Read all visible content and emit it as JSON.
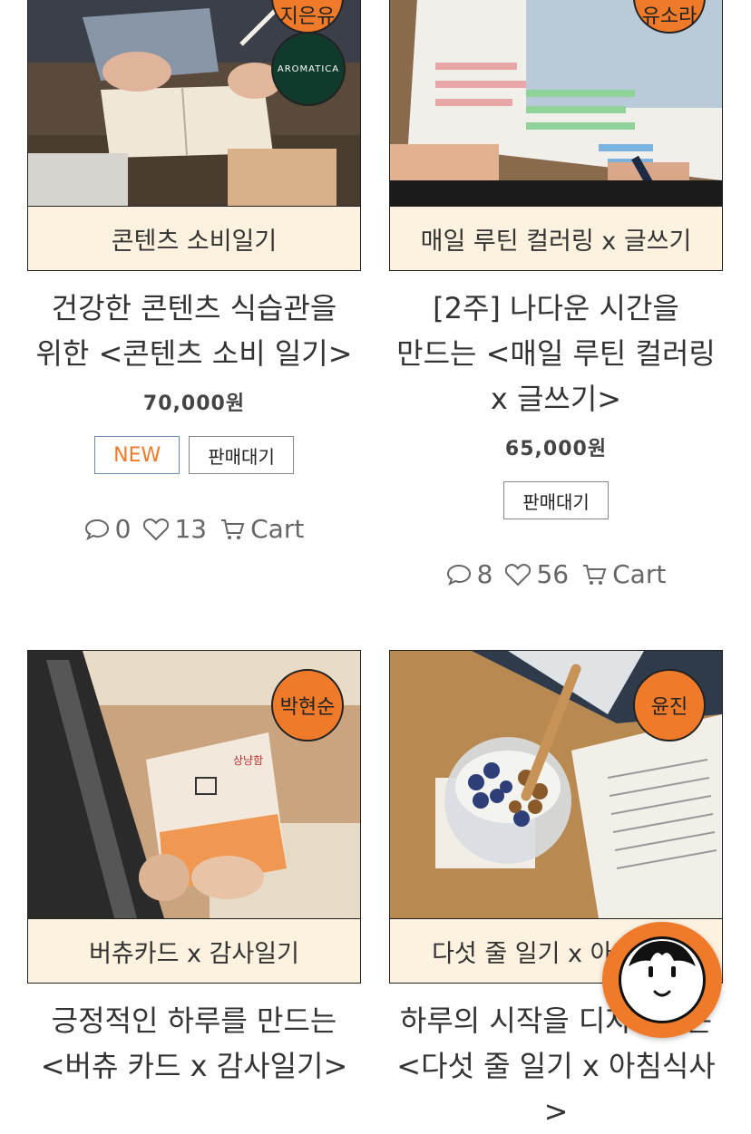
{
  "products": [
    {
      "badge": "지은유",
      "ribbon": "콘텐츠 소비일기",
      "title_lines": [
        "건강한 콘텐츠 식습관을",
        "위한 <콘텐츠 소비 일기>"
      ],
      "price": "70,000원",
      "tags": [
        "NEW",
        "판매대기"
      ],
      "comments": "0",
      "likes": "13",
      "cart_label": "Cart",
      "logo_text": "AROMATICA"
    },
    {
      "badge": "유소라",
      "ribbon": "매일 루틴 컬러링 x 글쓰기",
      "title_lines": [
        "[2주] 나다운 시간을",
        "만드는 <매일 루틴 컬러링",
        "x 글쓰기>"
      ],
      "price": "65,000원",
      "tags": [
        "판매대기"
      ],
      "comments": "8",
      "likes": "56",
      "cart_label": "Cart"
    },
    {
      "badge": "박현순",
      "ribbon": "버츄카드 x 감사일기",
      "title_lines": [
        "긍정적인 하루를 만드는",
        "<버츄 카드 x 감사일기>"
      ],
      "card_text": "상냥함"
    },
    {
      "badge": "윤진",
      "ribbon": "다섯 줄 일기 x 아침식사",
      "title_lines": [
        "하루의 시작을 디자인하는",
        "<다섯 줄 일기 x 아침식사>"
      ]
    }
  ],
  "colors": {
    "accent": "#ef7a2a",
    "ribbon_bg": "#fdf2df",
    "new_tag_border": "#6b8db5"
  },
  "fab_icon": "character-face-icon"
}
